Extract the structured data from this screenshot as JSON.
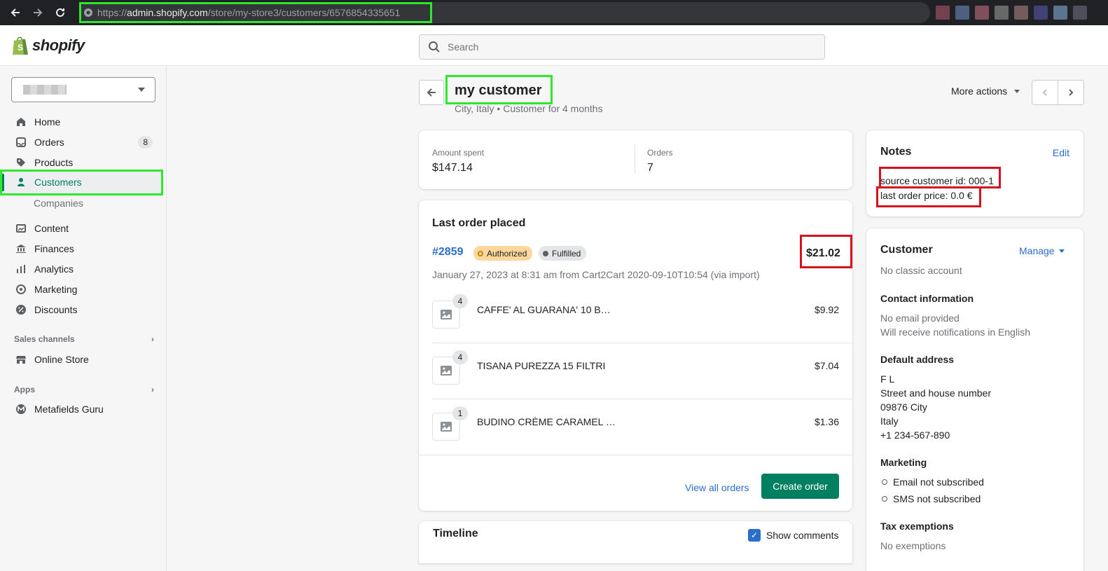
{
  "browser": {
    "url_scheme": "https://",
    "url_host": "admin.shopify.com",
    "url_path": "/store/my-store3/customers/6576854335651"
  },
  "header": {
    "logo_text": "shopify",
    "search_placeholder": "Search"
  },
  "sidebar": {
    "items": [
      {
        "label": "Home",
        "icon": "home-icon"
      },
      {
        "label": "Orders",
        "icon": "inbox-icon",
        "badge": "8"
      },
      {
        "label": "Products",
        "icon": "tag-icon"
      },
      {
        "label": "Customers",
        "icon": "person-icon"
      },
      {
        "label": "Companies"
      },
      {
        "label": "Content",
        "icon": "image-icon"
      },
      {
        "label": "Finances",
        "icon": "bank-icon"
      },
      {
        "label": "Analytics",
        "icon": "bar-chart-icon"
      },
      {
        "label": "Marketing",
        "icon": "target-icon"
      },
      {
        "label": "Discounts",
        "icon": "discount-icon"
      }
    ],
    "sales_channels_label": "Sales channels",
    "online_store_label": "Online Store",
    "apps_label": "Apps",
    "metafields_label": "Metafields Guru"
  },
  "page": {
    "title": "my customer",
    "subtitle": "City, Italy • Customer for 4 months",
    "more_actions": "More actions"
  },
  "stats": {
    "amount_label": "Amount spent",
    "amount_value": "$147.14",
    "orders_label": "Orders",
    "orders_value": "7"
  },
  "last_order": {
    "title": "Last order placed",
    "number": "#2859",
    "status_payment": "Authorized",
    "status_fulfillment": "Fulfilled",
    "total": "$21.02",
    "meta": "January 27, 2023 at 8:31 am from Cart2Cart 2020-09-10T10:54 (via import)",
    "items": [
      {
        "qty": "4",
        "name": "CAFFE' AL GUARANA' 10 B…",
        "price": "$9.92"
      },
      {
        "qty": "4",
        "name": "TISANA PUREZZA 15 FILTRI",
        "price": "$7.04"
      },
      {
        "qty": "1",
        "name": "BUDINO CRÈME CARAMEL …",
        "price": "$1.36"
      }
    ],
    "view_all": "View all orders",
    "create_order": "Create order"
  },
  "timeline": {
    "title": "Timeline",
    "show_comments": "Show comments",
    "show_comments_checked": true
  },
  "notes": {
    "title": "Notes",
    "edit": "Edit",
    "line1": "source customer id: 000-1",
    "line2": "last order price: 0.0 €"
  },
  "customer": {
    "title": "Customer",
    "manage": "Manage",
    "account": "No classic account",
    "contact_title": "Contact information",
    "email": "No email provided",
    "notifications": "Will receive notifications in English",
    "address_title": "Default address",
    "address": [
      "F L",
      "Street and house number",
      "09876 City",
      "Italy",
      "+1 234-567-890"
    ],
    "marketing_title": "Marketing",
    "email_marketing": "Email not subscribed",
    "sms_marketing": "SMS not subscribed",
    "tax_title": "Tax exemptions",
    "tax_value": "No exemptions"
  },
  "colors": {
    "accent_green": "#008060",
    "link_blue": "#2c6ecb",
    "highlight_green": "#2ee82e",
    "highlight_red": "#d70f1e"
  }
}
